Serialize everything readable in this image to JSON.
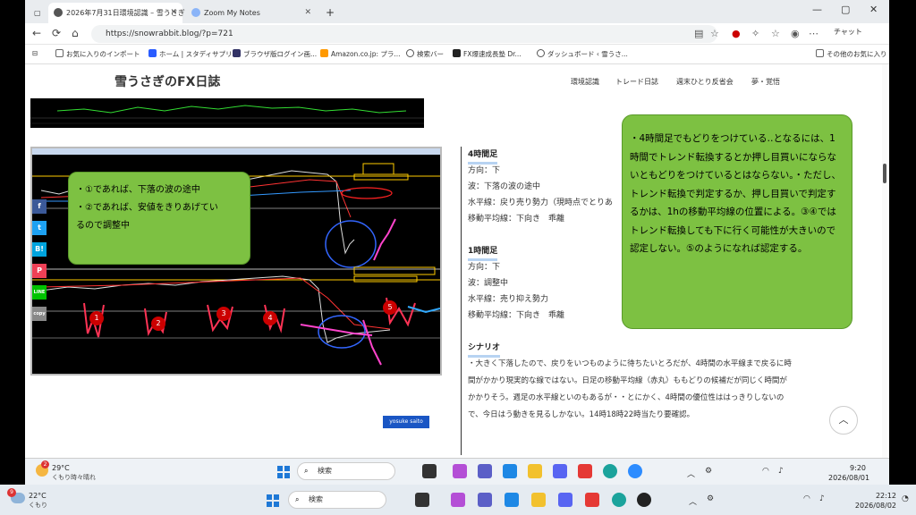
{
  "browser": {
    "tabs": [
      {
        "label": "2026年7月31日環境認識 – 雪うさぎ"
      },
      {
        "label": "Zoom My Notes"
      }
    ],
    "new_tab": "+",
    "url": "https://snowrabbit.blog/?p=721",
    "chat_label": "チャット",
    "bookmarks": [
      "お気に入りのインポート",
      "ホーム | スタディサプリ...",
      "ブラウザ版ログイン画...",
      "Amazon.co.jp: プラ...",
      "検索バー",
      "FX爆速成長塾 Dr...",
      "ダッシュボード ‹ 雪うさ...",
      "その他のお気に入り"
    ]
  },
  "site": {
    "title": "雪うさぎのFX日誌",
    "nav": [
      "環境認識",
      "トレード日誌",
      "週末ひとり反省会",
      "夢・覚悟"
    ]
  },
  "share_buttons": [
    "f",
    "t",
    "B!",
    "P",
    "LINE",
    "copy"
  ],
  "callout_left": {
    "lines": [
      "・①であれば、下落の波の途中",
      "・②であれば、安値をきりあげてい",
      "るので調整中"
    ]
  },
  "callout_right": {
    "text": "・4時間足でもどりをつけている‥となるには、1時間でトレンド転換するとか押し目買いにならないともどりをつけているとはならない。・ただし、トレンド転換で判定するか、押し目買いで判定するかは、1hの移動平均線の位置による。③④ではトレンド転換しても下に行く可能性が大きいので認定しない。⑤のようになれば認定する。"
  },
  "chart_annotations": [
    "1",
    "2",
    "3",
    "4",
    "5"
  ],
  "name_tag": "yosuke saito",
  "article": {
    "h4_title": "4時間足",
    "h4_dir": "方向：下",
    "h4_wave": "波：下落の波の途中",
    "h4_level": "水平線：戻り売り勢力（現時点でとりあ",
    "h4_ma": "移動平均線：下向き　乖離",
    "h1_title": "1時間足",
    "h1_dir": "方向：下",
    "h1_wave": "波：調整中",
    "h1_level": "水平線：売り抑え勢力",
    "h1_ma": "移動平均線：下向き　乖離",
    "scenario_title": "シナリオ",
    "scenario_text": "・大きく下落したので、戻りをいつものように待ちたいとろだが、4時間の水平線まで戻るに時間がかかり現実的な線ではない。日足の移動平均線（赤丸）ももどりの候補だが同じく時間がかかりそう。週足の水平線といのもあるが・・とにかく、4時間の優位性ははっきりしないので、今日はう動きを見るしかない。14時18時22時当たり要確認。"
  },
  "taskbar_inner": {
    "temp": "29°C",
    "weather": "くもり時々晴れ",
    "badge": "2",
    "search": "検索",
    "time": "9:20",
    "date": "2026/08/01"
  },
  "taskbar_outer": {
    "temp": "22°C",
    "weather": "くもり",
    "badge": "9",
    "search": "検索",
    "time": "22:12",
    "date": "2026/08/02"
  },
  "colors": {
    "callout": "#7dc142",
    "chart_bg": "#000000",
    "accent_link": "#1a56c4"
  }
}
